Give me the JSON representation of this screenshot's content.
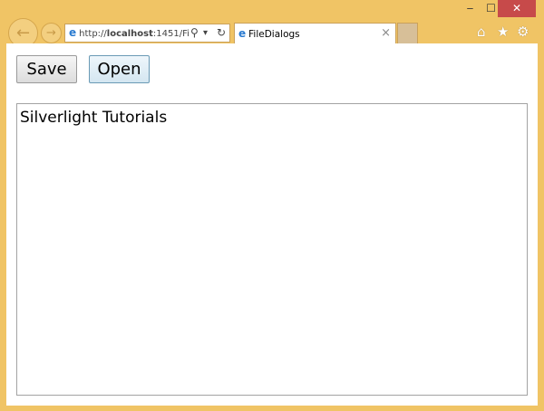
{
  "window": {
    "minimize": "‒",
    "maximize": "☐",
    "close": "✕"
  },
  "nav": {
    "back": "←",
    "forward": "→"
  },
  "address": {
    "prefix": "http://",
    "host": "localhost",
    "rest": ":1451/Fi",
    "search_icon": "⚲",
    "dropdown": "▾",
    "refresh": "↻"
  },
  "tab": {
    "title": "FileDialogs",
    "close": "×"
  },
  "toolbar_icons": {
    "home": "⌂",
    "favorites": "★",
    "settings": "⚙"
  },
  "page": {
    "save_label": "Save",
    "open_label": "Open",
    "textbox_value": "Silverlight Tutorials"
  }
}
